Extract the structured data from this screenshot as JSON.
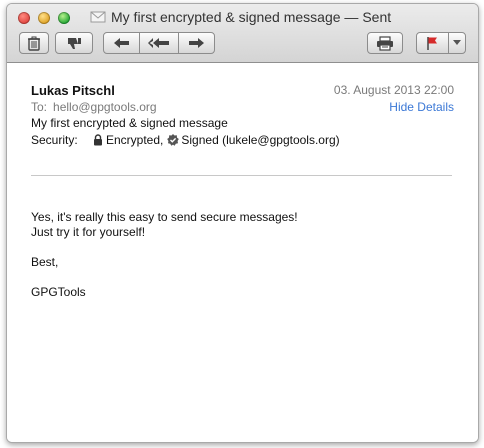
{
  "window": {
    "title": "My first encrypted & signed message — Sent"
  },
  "toolbar": {
    "buttons": [
      "delete",
      "junk",
      "reply",
      "reply-all",
      "forward",
      "print",
      "flag"
    ]
  },
  "message": {
    "from": "Lukas Pitschl",
    "date": "03. August 2013 22:00",
    "to_label": "To:",
    "to": "hello@gpgtools.org",
    "hide_details": "Hide Details",
    "subject": "My first encrypted & signed message",
    "security_label": "Security:",
    "encrypted": "Encrypted,",
    "signed": "Signed (lukele@gpgtools.org)",
    "body": {
      "line1": "Yes, it's really this easy to send secure messages!",
      "line2": "Just try it for yourself!",
      "line3": "Best,",
      "line4": "GPGTools"
    }
  },
  "colors": {
    "link": "#3b78d6",
    "flag": "#d62b2b",
    "meta": "#7a7a7a"
  }
}
